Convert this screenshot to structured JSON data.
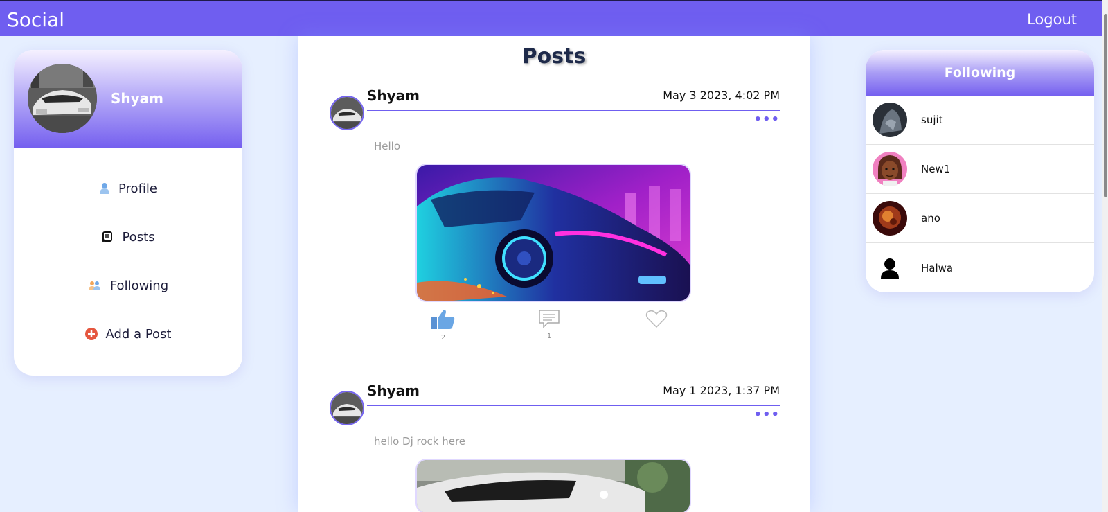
{
  "app": {
    "brand": "Social",
    "logout_label": "Logout"
  },
  "user": {
    "name": "Shyam"
  },
  "nav": [
    {
      "label": "Profile",
      "icon": "user-icon"
    },
    {
      "label": "Posts",
      "icon": "scroll-icon"
    },
    {
      "label": "Following",
      "icon": "users-icon"
    },
    {
      "label": "Add a Post",
      "icon": "plus-circle-icon"
    }
  ],
  "main": {
    "title": "Posts",
    "posts": [
      {
        "author": "Shyam",
        "date": "May 3 2023, 4:02 PM",
        "text": "Hello",
        "more": "•••",
        "likes": "2",
        "comments": "1"
      },
      {
        "author": "Shyam",
        "date": "May 1 2023, 1:37 PM",
        "text": "hello Dj rock here",
        "more": "•••"
      }
    ]
  },
  "following": {
    "title": "Following",
    "users": [
      {
        "name": "sujit"
      },
      {
        "name": "New1"
      },
      {
        "name": "ano"
      },
      {
        "name": "Halwa"
      }
    ]
  },
  "colors": {
    "accent": "#6f5ef0",
    "background": "#e6efff",
    "like": "#4f8fd4"
  }
}
